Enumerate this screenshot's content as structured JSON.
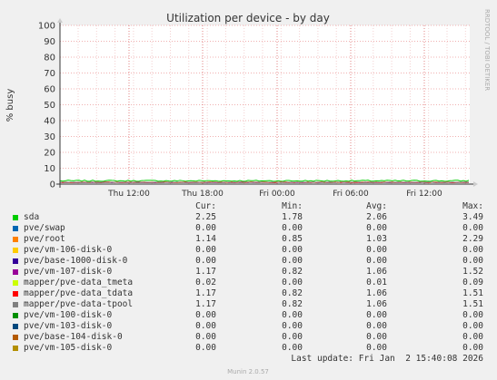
{
  "chart_data": {
    "type": "line",
    "title": "Utilization per device - by day",
    "ylabel": "% busy",
    "ylim": [
      0,
      100
    ],
    "yticks": [
      "0",
      "10",
      "20",
      "30",
      "40",
      "50",
      "60",
      "70",
      "80",
      "90",
      "100"
    ],
    "xticks": [
      "Thu 12:00",
      "Thu 18:00",
      "Fri 00:00",
      "Fri 06:00",
      "Fri 12:00"
    ],
    "side_label": "RRDTOOL / TOBI OETIKER",
    "footer": "Munin 2.0.57",
    "last_update": "Last update: Fri Jan  2 15:40:08 2026",
    "grid": true,
    "columns": [
      "Cur:",
      "Min:",
      "Avg:",
      "Max:"
    ],
    "series": [
      {
        "name": "sda",
        "color": "#00cc00",
        "cur": "2.25",
        "min": "1.78",
        "avg": "2.06",
        "max": "3.49"
      },
      {
        "name": "pve/swap",
        "color": "#0066b3",
        "cur": "0.00",
        "min": "0.00",
        "avg": "0.00",
        "max": "0.00"
      },
      {
        "name": "pve/root",
        "color": "#ff8000",
        "cur": "1.14",
        "min": "0.85",
        "avg": "1.03",
        "max": "2.29"
      },
      {
        "name": "pve/vm-106-disk-0",
        "color": "#ffcc00",
        "cur": "0.00",
        "min": "0.00",
        "avg": "0.00",
        "max": "0.00"
      },
      {
        "name": "pve/base-1000-disk-0",
        "color": "#330099",
        "cur": "0.00",
        "min": "0.00",
        "avg": "0.00",
        "max": "0.00"
      },
      {
        "name": "pve/vm-107-disk-0",
        "color": "#990099",
        "cur": "1.17",
        "min": "0.82",
        "avg": "1.06",
        "max": "1.52"
      },
      {
        "name": "mapper/pve-data_tmeta",
        "color": "#ccff00",
        "cur": "0.02",
        "min": "0.00",
        "avg": "0.01",
        "max": "0.09"
      },
      {
        "name": "mapper/pve-data_tdata",
        "color": "#ff0000",
        "cur": "1.17",
        "min": "0.82",
        "avg": "1.06",
        "max": "1.51"
      },
      {
        "name": "mapper/pve-data-tpool",
        "color": "#808080",
        "cur": "1.17",
        "min": "0.82",
        "avg": "1.06",
        "max": "1.51"
      },
      {
        "name": "pve/vm-100-disk-0",
        "color": "#008f00",
        "cur": "0.00",
        "min": "0.00",
        "avg": "0.00",
        "max": "0.00"
      },
      {
        "name": "pve/vm-103-disk-0",
        "color": "#00487d",
        "cur": "0.00",
        "min": "0.00",
        "avg": "0.00",
        "max": "0.00"
      },
      {
        "name": "pve/base-104-disk-0",
        "color": "#b35a00",
        "cur": "0.00",
        "min": "0.00",
        "avg": "0.00",
        "max": "0.00"
      },
      {
        "name": "pve/vm-105-disk-0",
        "color": "#b38f00",
        "cur": "0.00",
        "min": "0.00",
        "avg": "0.00",
        "max": "0.00"
      }
    ]
  }
}
